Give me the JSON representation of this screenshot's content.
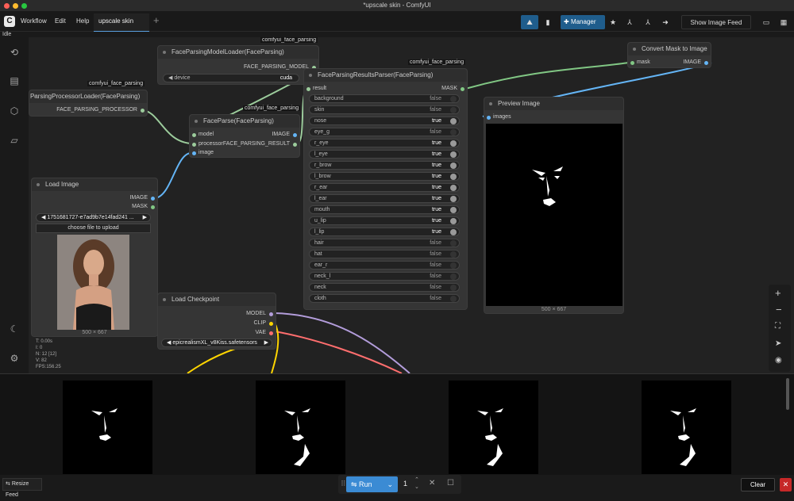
{
  "window": {
    "title": "*upscale skin - ComfyUI"
  },
  "menu": {
    "logo": "C",
    "workflow": "Workflow",
    "edit": "Edit",
    "help": "Help",
    "tab": "upscale skin",
    "add": "+"
  },
  "toolbar": {
    "manager": "Manager",
    "show_feed": "Show Image Feed"
  },
  "status": "Idle",
  "nodes": {
    "fpml": {
      "title": "FaceParsingModelLoader(FaceParsing)",
      "group": "comfyui_face_parsing",
      "out": "FACE_PARSING_MODEL",
      "widget_label": "device",
      "widget_value": "cuda"
    },
    "fppl": {
      "title": "ParsingProcessorLoader(FaceParsing)",
      "group": "comfyui_face_parsing",
      "out": "FACE_PARSING_PROCESSOR"
    },
    "fp": {
      "title": "FaceParse(FaceParsing)",
      "group": "comfyui_face_parsing",
      "in": [
        "model",
        "processor",
        "image"
      ],
      "out1": "IMAGE",
      "out2": "FACE_PARSING_RESULT"
    },
    "fprp": {
      "title": "FaceParsingResultsParser(FaceParsing)",
      "group": "comfyui_face_parsing",
      "in": "result",
      "out": "MASK",
      "params": [
        [
          "background",
          "false"
        ],
        [
          "skin",
          "false"
        ],
        [
          "nose",
          "true"
        ],
        [
          "eye_g",
          "false"
        ],
        [
          "r_eye",
          "true"
        ],
        [
          "l_eye",
          "true"
        ],
        [
          "r_brow",
          "true"
        ],
        [
          "l_brow",
          "true"
        ],
        [
          "r_ear",
          "true"
        ],
        [
          "l_ear",
          "true"
        ],
        [
          "mouth",
          "true"
        ],
        [
          "u_lip",
          "true"
        ],
        [
          "l_lip",
          "true"
        ],
        [
          "hair",
          "false"
        ],
        [
          "hat",
          "false"
        ],
        [
          "ear_r",
          "false"
        ],
        [
          "neck_l",
          "false"
        ],
        [
          "neck",
          "false"
        ],
        [
          "cloth",
          "false"
        ]
      ]
    },
    "cmi": {
      "title": "Convert Mask to Image",
      "in": "mask",
      "out": "IMAGE"
    },
    "preview": {
      "title": "Preview Image",
      "in": "images",
      "size": "500 × 667"
    },
    "load": {
      "title": "Load Image",
      "out1": "IMAGE",
      "out2": "MASK",
      "file": "1751681727-e7ad9b7e14fad241 ...",
      "upload": "choose file to upload",
      "size": "500 × 667"
    },
    "ckpt": {
      "title": "Load Checkpoint",
      "out1": "MODEL",
      "out2": "CLIP",
      "out3": "VAE",
      "value": "epicrealismXL_v8Kiss.safetensors"
    }
  },
  "stats": {
    "t": "T: 0.00s",
    "i": "I: 0",
    "n": "N: 12 [12]",
    "v": "V: 82",
    "fps": "FPS:156.25"
  },
  "bottom": {
    "resize": "Resize Feed",
    "run": "Run",
    "count": "1",
    "clear": "Clear"
  },
  "colors": {
    "model": "#b39ddb",
    "clip": "#ffd500",
    "vae": "#ff6e6e",
    "image": "#64b5f6",
    "mask": "#81c784",
    "faceparse": "#9ccc9c"
  }
}
